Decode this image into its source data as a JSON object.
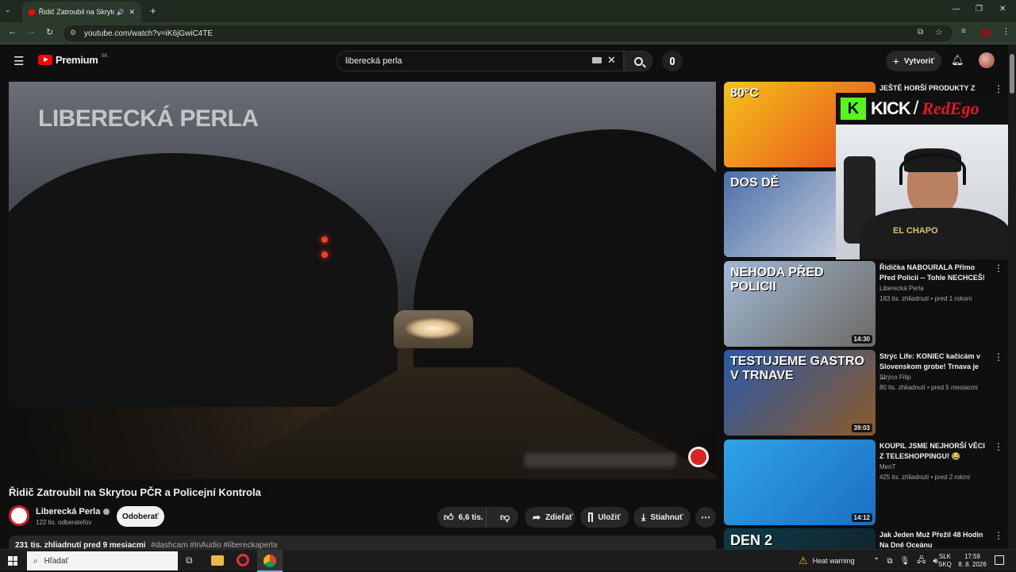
{
  "browser": {
    "tab_title": "Řidič Zatroubil na Skrytou P",
    "url": "youtube.com/watch?v=iK6jGwiC4TE",
    "new_tab_label": "+"
  },
  "youtube": {
    "logo_text": "Premium",
    "country_code": "SK",
    "search_value": "liberecká perla",
    "create_label": "Vytvoriť"
  },
  "video": {
    "watermark": "LIBERECKÁ PERLA",
    "title": "Řidič Zatroubil na Skrytou PČR a Policejní Kontrola",
    "channel": "Liberecká Perla",
    "subscribers": "122 tis. odberateľov",
    "subscribe_label": "Odoberať",
    "likes": "6,6 tis.",
    "share_label": "Zdieľať",
    "save_label": "Uložiť",
    "download_label": "Stiahnuť",
    "description_stats": "231 tis. zhliadnutí  pred 9 mesiacmi",
    "description_tags": "#dashcam #InAudio #libereckaperla"
  },
  "overlay": {
    "kick_letter": "K",
    "kick_text": "KICK",
    "slash": "/",
    "streamer": "RedEgo",
    "shirt_text": "EL CHAPO"
  },
  "recommendations": [
    {
      "title": "JEŠTĚ HORŠÍ PRODUKTY Z",
      "channel": "",
      "meta": "",
      "duration": "",
      "thumb_text": "80°C",
      "colors": [
        "#f4c21b",
        "#e84b1c"
      ]
    },
    {
      "title": "",
      "channel": "",
      "meta": "",
      "duration": "",
      "thumb_text": "DOS DĚ",
      "colors": [
        "#4b6ea8",
        "#d9dee6"
      ]
    },
    {
      "title": "Řidička NABOURALA Přímo Před Policií -- Tohle NECHCEŠ!",
      "channel": "Liberecká Perla",
      "meta": "183 tis. zhliadnutí • pred 1 rokom",
      "duration": "14:30",
      "thumb_text": "NEHODA PŘED POLICII",
      "colors": [
        "#9fb8d6",
        "#6d6a62"
      ]
    },
    {
      "title": "Strýc Life: KONIEC kačicám v Slovenskom grobe! Trnava je ...",
      "channel": "Strýco Filip",
      "meta": "80 tis. zhliadnutí • pred 5 mesiacmi",
      "duration": "39:03",
      "thumb_text": "TESTUJEME GASTRO V TRNAVE",
      "colors": [
        "#2a5aa8",
        "#8a5a2a"
      ]
    },
    {
      "title": "KOUPIL JSME NEJHORŠÍ VĚCI Z TELESHOPPINGU! 😂",
      "channel": "MenT",
      "meta": "425 tis. zhliadnutí • pred 2 rokmi",
      "duration": "14:12",
      "thumb_text": "",
      "colors": [
        "#2fa3e8",
        "#1b6fc2"
      ]
    },
    {
      "title": "Jak Jeden Muž Přežil 48 Hodin Na Dně Oceánu",
      "channel": "",
      "meta": "",
      "duration": "",
      "thumb_text": "DEN 2",
      "colors": [
        "#0d3a4a",
        "#11262e"
      ]
    }
  ],
  "taskbar": {
    "search_placeholder": "Hľadať",
    "weather": "Heat warning",
    "lang_top": "SLK",
    "lang_bottom": "SKQ",
    "time": "17:59",
    "date": "8. 8. 2026"
  }
}
